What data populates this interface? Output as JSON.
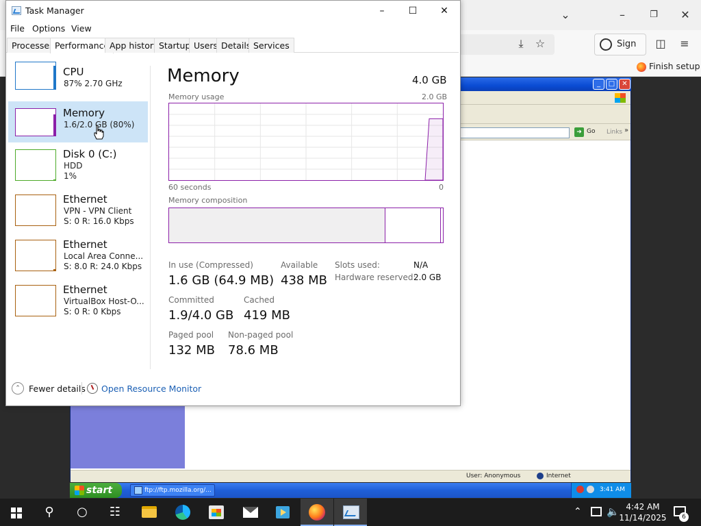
{
  "browser": {
    "signin_label": "Sign in",
    "finish_setup_label": "Finish setup",
    "icons": [
      "chevron-down-icon",
      "minimize-icon",
      "maximize-icon",
      "close-icon",
      "download-icon",
      "star-icon",
      "extensions-icon",
      "menu-icon"
    ]
  },
  "xp": {
    "go_label": "Go",
    "links_label": "Links",
    "status_user": "User: Anonymous",
    "status_zone": "Internet",
    "start_label": "start",
    "task_button": "ftp://ftp.mozilla.org/...",
    "clock": "3:41 AM"
  },
  "taskmgr": {
    "title": "Task Manager",
    "menu": [
      "File",
      "Options",
      "View"
    ],
    "tabs": [
      "Processes",
      "Performance",
      "App history",
      "Startup",
      "Users",
      "Details",
      "Services"
    ],
    "active_tab": "Performance",
    "resources": [
      {
        "name": "CPU",
        "sub1": "87%  2.70 GHz",
        "sub2": "",
        "sub3": "",
        "color": "#1f77c9",
        "level": 0.87
      },
      {
        "name": "Memory",
        "sub1": "1.6/2.0 GB (80%)",
        "sub2": "",
        "sub3": "",
        "color": "#8b1fa8",
        "level": 0.8
      },
      {
        "name": "Disk 0 (C:)",
        "sub1": "HDD",
        "sub2": "1%",
        "sub3": "",
        "color": "#4caa28",
        "level": 0.01
      },
      {
        "name": "Ethernet",
        "sub1": "VPN - VPN Client",
        "sub2": "S: 0  R: 16.0 Kbps",
        "sub3": "",
        "color": "#a8600f",
        "level": 0.0
      },
      {
        "name": "Ethernet",
        "sub1": "Local Area Conne...",
        "sub2": "S: 8.0  R: 24.0 Kbps",
        "sub3": "",
        "color": "#a8600f",
        "level": 0.05
      },
      {
        "name": "Ethernet",
        "sub1": "VirtualBox Host-O...",
        "sub2": "S: 0  R: 0 Kbps",
        "sub3": "",
        "color": "#a8600f",
        "level": 0.0
      }
    ],
    "detail": {
      "title": "Memory",
      "total": "4.0 GB",
      "usage_label": "Memory usage",
      "usage_max": "2.0 GB",
      "time_left": "60 seconds",
      "time_right": "0",
      "composition_label": "Memory composition",
      "in_use_fraction": 0.79,
      "stats": {
        "in_use_label": "In use (Compressed)",
        "in_use_value": "1.6 GB (64.9 MB)",
        "available_label": "Available",
        "available_value": "438 MB",
        "committed_label": "Committed",
        "committed_value": "1.9/4.0 GB",
        "cached_label": "Cached",
        "cached_value": "419 MB",
        "paged_label": "Paged pool",
        "paged_value": "132 MB",
        "nonpaged_label": "Non-paged pool",
        "nonpaged_value": "78.6 MB",
        "slots_label": "Slots used:",
        "slots_value": "N/A",
        "hw_reserved_label": "Hardware reserved:",
        "hw_reserved_value": "2.0 GB"
      }
    },
    "footer": {
      "fewer_details": "Fewer details",
      "open_resmon": "Open Resource Monitor"
    }
  },
  "win_taskbar": {
    "time": "4:42 AM",
    "date": "11/14/2025",
    "notification_count": "6"
  }
}
